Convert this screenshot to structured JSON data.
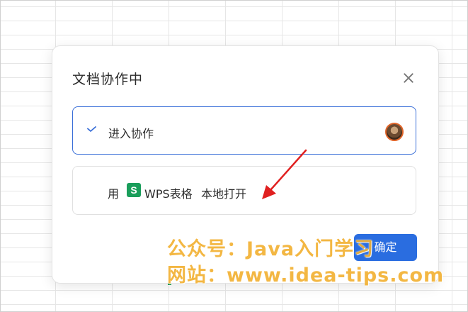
{
  "dialog": {
    "title": "文档协作中",
    "close_icon": "close-icon",
    "options": {
      "collaborate": {
        "label": "进入协作",
        "selected": true,
        "check_icon": "check-icon",
        "avatar_icon": "user-avatar"
      },
      "open_local": {
        "prefix": "用",
        "app_icon_letter": "S",
        "app_name": "WPS表格",
        "suffix": "本地打开"
      }
    },
    "confirm_label": "确定"
  },
  "colors": {
    "accent": "#2a6de0",
    "selected_border": "#3a6fd8",
    "wps_green": "#1a9e5b",
    "annotation_arrow": "#e02020",
    "watermark": "#f2b134"
  },
  "watermark": {
    "line1": "公众号：Java入门学习",
    "line2": "网站：www.idea-tips.com"
  }
}
